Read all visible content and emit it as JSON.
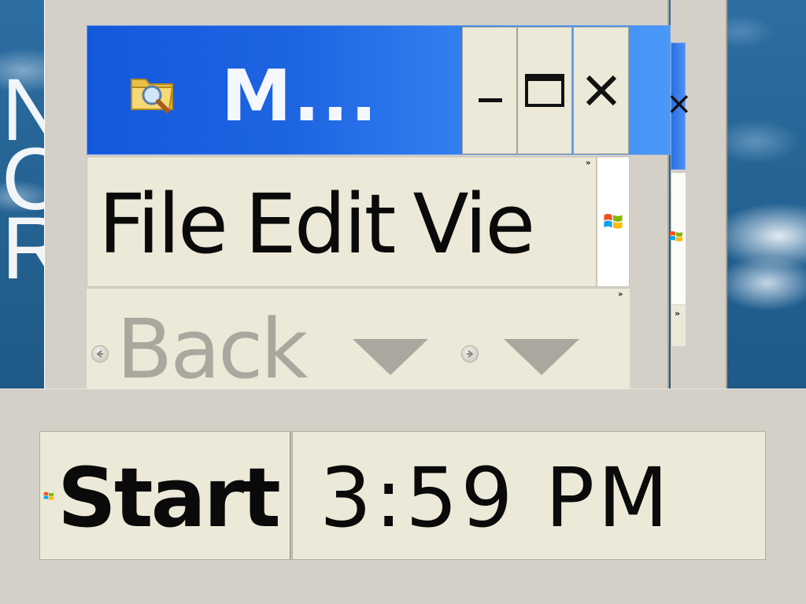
{
  "desktop": {
    "letters": [
      "N",
      "C",
      "R"
    ]
  },
  "window": {
    "title": "M...",
    "icon": "folder-search-icon",
    "caption_buttons": {
      "minimize": "minimize-icon",
      "maximize": "maximize-icon",
      "close": "close-icon"
    }
  },
  "menubar": {
    "items": [
      "File",
      "Edit",
      "Vie"
    ],
    "overflow": "»",
    "throbber_icon": "windows-logo-icon"
  },
  "toolbar": {
    "back_label": "Back",
    "overflow": "»",
    "back_icon": "back-arrow-icon",
    "forward_icon": "forward-arrow-icon"
  },
  "background_window": {
    "overflow": "»",
    "logo_icon": "windows-logo-icon"
  },
  "taskbar": {
    "start_label": "Start",
    "start_icon": "windows-flag-icon",
    "clock": "3:59 PM"
  },
  "colors": {
    "titlebar_start": "#1459dc",
    "titlebar_end": "#4a98f8",
    "chrome": "#ece9d8",
    "disabled_text": "#aaa89e"
  }
}
